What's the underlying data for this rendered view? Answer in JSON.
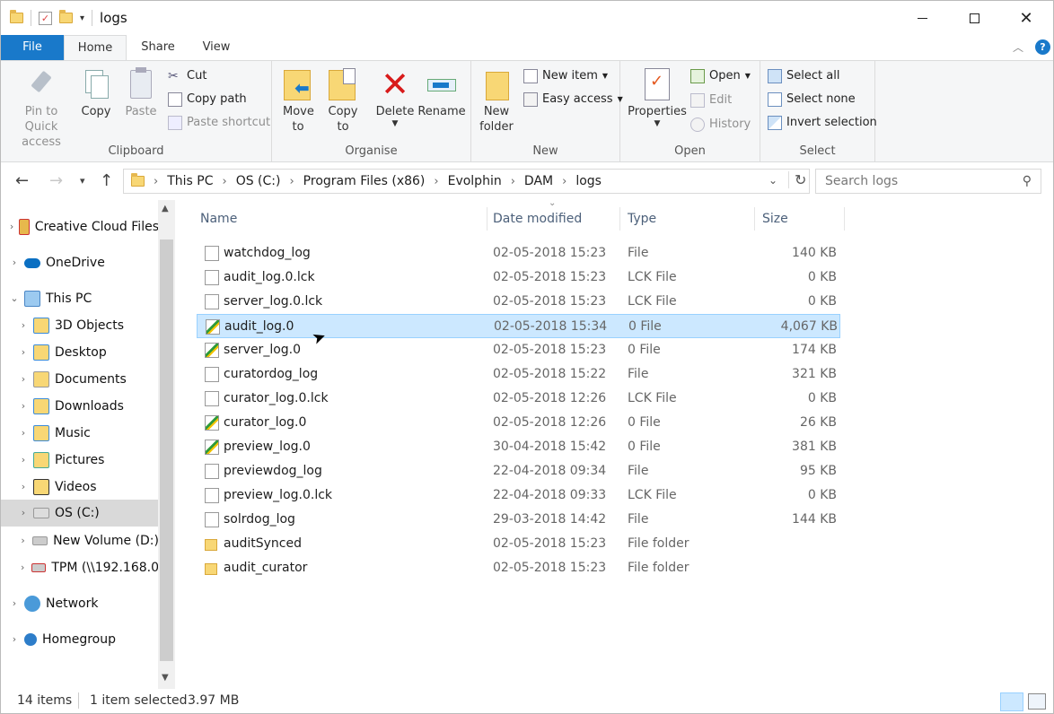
{
  "window": {
    "title": "logs"
  },
  "tabs": {
    "file": "File",
    "home": "Home",
    "share": "Share",
    "view": "View"
  },
  "ribbon": {
    "clipboard": {
      "label": "Clipboard",
      "pin": "Pin to Quick access",
      "copy": "Copy",
      "paste": "Paste",
      "cut": "Cut",
      "copy_path": "Copy path",
      "paste_shortcut": "Paste shortcut"
    },
    "organise": {
      "label": "Organise",
      "move_to": "Move to",
      "copy_to": "Copy to",
      "delete": "Delete",
      "rename": "Rename"
    },
    "new": {
      "label": "New",
      "new_folder": "New folder",
      "new_item": "New item",
      "easy_access": "Easy access"
    },
    "open": {
      "label": "Open",
      "properties": "Properties",
      "open": "Open",
      "edit": "Edit",
      "history": "History"
    },
    "select": {
      "label": "Select",
      "select_all": "Select all",
      "select_none": "Select none",
      "invert": "Invert selection"
    }
  },
  "address": {
    "crumbs": [
      "This PC",
      "OS (C:)",
      "Program Files (x86)",
      "Evolphin",
      "DAM",
      "logs"
    ],
    "search_placeholder": "Search logs"
  },
  "nav": [
    {
      "label": "Creative Cloud Files",
      "icon": "creative-cloud-icon"
    },
    {
      "label": "OneDrive",
      "icon": "onedrive-icon"
    },
    {
      "label": "This PC",
      "icon": "computer-icon"
    },
    {
      "label": "3D Objects",
      "icon": "3d-objects-icon"
    },
    {
      "label": "Desktop",
      "icon": "desktop-icon"
    },
    {
      "label": "Documents",
      "icon": "documents-icon"
    },
    {
      "label": "Downloads",
      "icon": "downloads-icon"
    },
    {
      "label": "Music",
      "icon": "music-icon"
    },
    {
      "label": "Pictures",
      "icon": "pictures-icon"
    },
    {
      "label": "Videos",
      "icon": "videos-icon"
    },
    {
      "label": "OS (C:)",
      "icon": "drive-c-icon"
    },
    {
      "label": "New Volume (D:)",
      "icon": "drive-d-icon"
    },
    {
      "label": "TPM (\\\\192.168.0",
      "icon": "network-drive-icon"
    },
    {
      "label": "Network",
      "icon": "network-icon"
    },
    {
      "label": "Homegroup",
      "icon": "homegroup-icon"
    }
  ],
  "columns": {
    "name": "Name",
    "date": "Date modified",
    "type": "Type",
    "size": "Size"
  },
  "files": [
    {
      "name": "watchdog_log",
      "date": "02-05-2018 15:23",
      "type": "File",
      "size": "140 KB",
      "icon": "file-icon"
    },
    {
      "name": "audit_log.0.lck",
      "date": "02-05-2018 15:23",
      "type": "LCK File",
      "size": "0 KB",
      "icon": "file-icon"
    },
    {
      "name": "server_log.0.lck",
      "date": "02-05-2018 15:23",
      "type": "LCK File",
      "size": "0 KB",
      "icon": "file-icon"
    },
    {
      "name": "audit_log.0",
      "date": "02-05-2018 15:34",
      "type": "0 File",
      "size": "4,067 KB",
      "icon": "log-file-icon"
    },
    {
      "name": "server_log.0",
      "date": "02-05-2018 15:23",
      "type": "0 File",
      "size": "174 KB",
      "icon": "log-file-icon"
    },
    {
      "name": "curatordog_log",
      "date": "02-05-2018 15:22",
      "type": "File",
      "size": "321 KB",
      "icon": "file-icon"
    },
    {
      "name": "curator_log.0.lck",
      "date": "02-05-2018 12:26",
      "type": "LCK File",
      "size": "0 KB",
      "icon": "file-icon"
    },
    {
      "name": "curator_log.0",
      "date": "02-05-2018 12:26",
      "type": "0 File",
      "size": "26 KB",
      "icon": "log-file-icon"
    },
    {
      "name": "preview_log.0",
      "date": "30-04-2018 15:42",
      "type": "0 File",
      "size": "381 KB",
      "icon": "log-file-icon"
    },
    {
      "name": "previewdog_log",
      "date": "22-04-2018 09:34",
      "type": "File",
      "size": "95 KB",
      "icon": "file-icon"
    },
    {
      "name": "preview_log.0.lck",
      "date": "22-04-2018 09:33",
      "type": "LCK File",
      "size": "0 KB",
      "icon": "file-icon"
    },
    {
      "name": "solrdog_log",
      "date": "29-03-2018 14:42",
      "type": "File",
      "size": "144 KB",
      "icon": "file-icon"
    },
    {
      "name": "auditSynced",
      "date": "02-05-2018 15:23",
      "type": "File folder",
      "size": "",
      "icon": "folder-icon"
    },
    {
      "name": "audit_curator",
      "date": "02-05-2018 15:23",
      "type": "File folder",
      "size": "",
      "icon": "folder-icon"
    }
  ],
  "selected_index": 3,
  "status": {
    "items": "14 items",
    "selected": "1 item selected",
    "size": "3.97 MB"
  }
}
